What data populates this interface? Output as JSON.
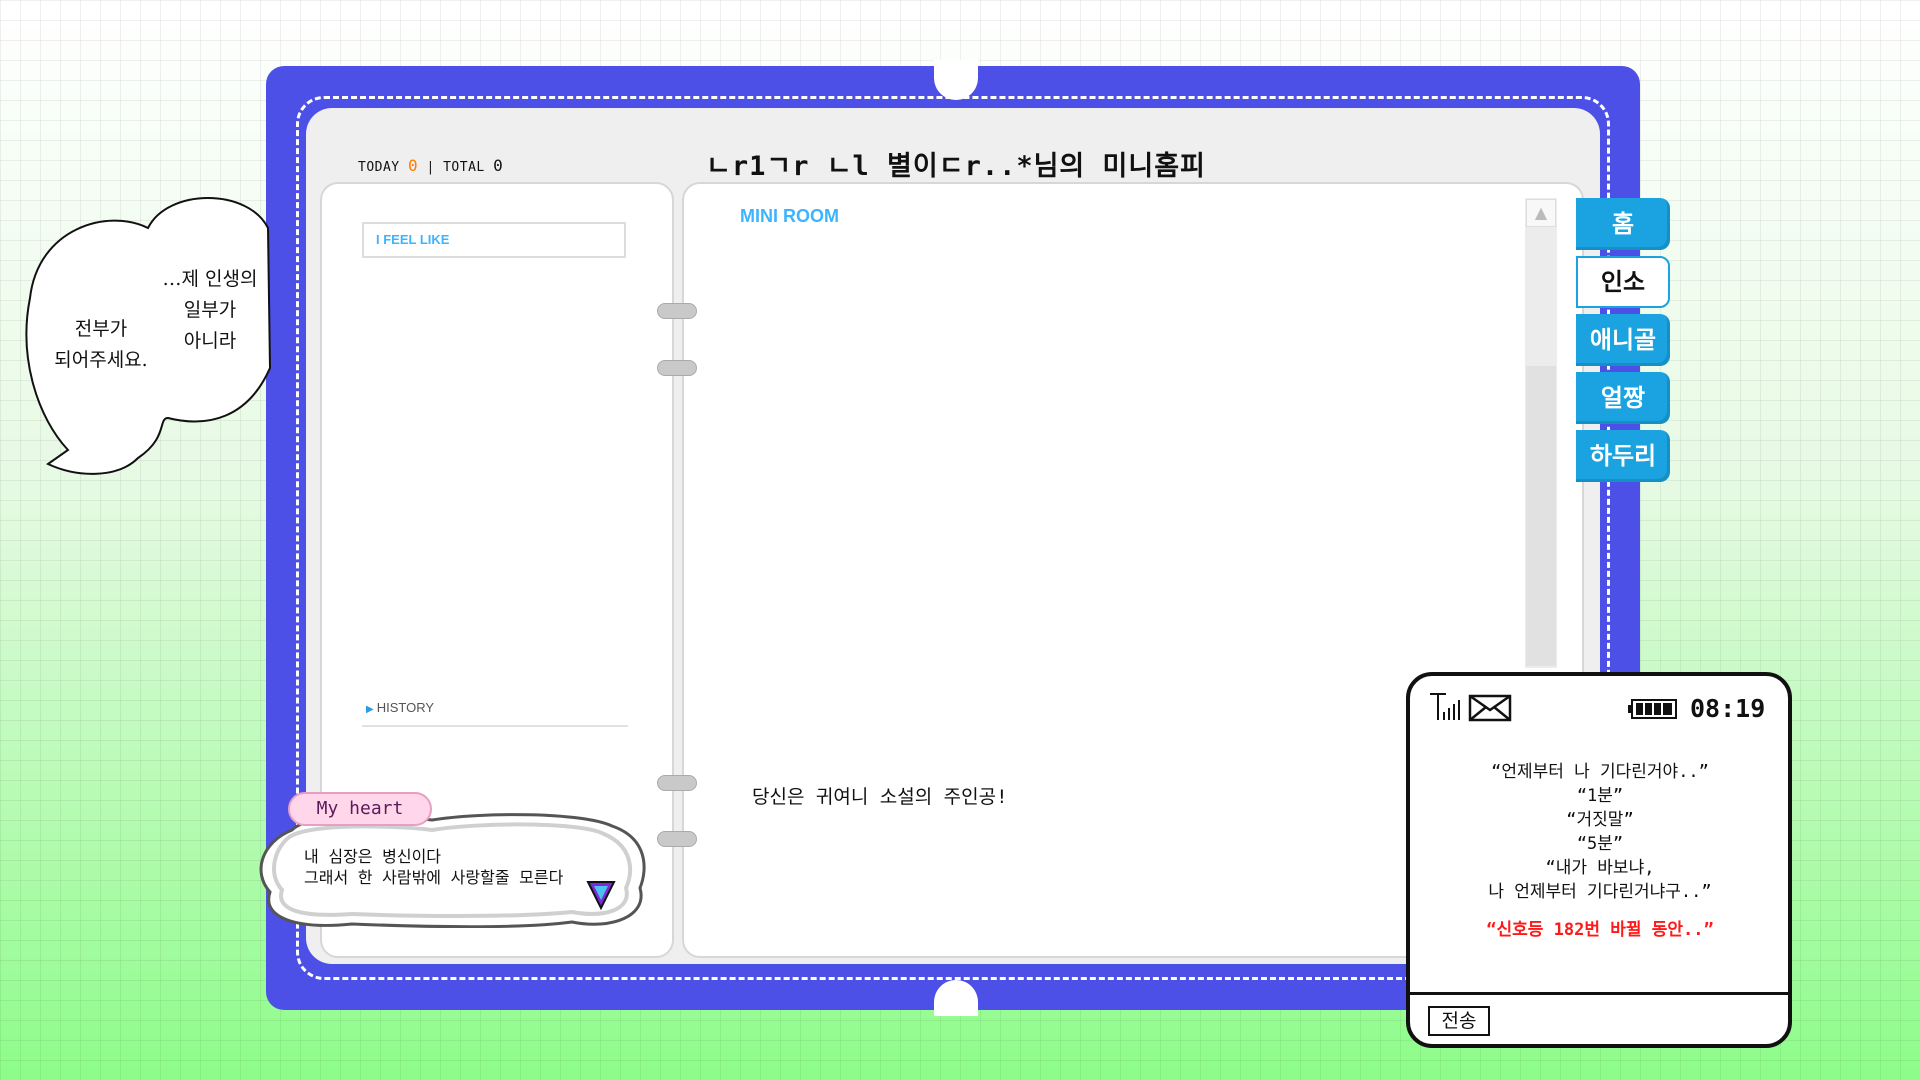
{
  "counter": {
    "today_label": "TODAY",
    "today_value": "0",
    "separator": "|",
    "total_label": "TOTAL",
    "total_value": "0"
  },
  "page_title": "ㄴr1ㄱr ㄴl 별이ㄷr..*님의 미니홈피",
  "left_panel": {
    "feel_label": "I FEEL LIKE",
    "history_label": "HISTORY"
  },
  "main": {
    "section_title": "MINI ROOM",
    "room_text": "당신은 귀여니 소설의 주인공!"
  },
  "tabs": [
    {
      "label": "홈",
      "active": false
    },
    {
      "label": "인소",
      "active": true
    },
    {
      "label": "애니골",
      "active": false
    },
    {
      "label": "얼짱",
      "active": false
    },
    {
      "label": "하두리",
      "active": false
    }
  ],
  "thought_cloud": {
    "line_right_1": "…제 인생의",
    "line_right_2": "일부가",
    "line_right_3": "아니라",
    "line_left_1": "전부가",
    "line_left_2": "되어주세요."
  },
  "heart": {
    "label": "My heart",
    "line1": "내 심장은 병신이다",
    "line2": "그래서 한 사람밖에 사랑할줄 모른다"
  },
  "phone": {
    "time": "08:19",
    "lines": [
      "“언제부터 나 기다린거야..”",
      "“1분”",
      "“거짓말”",
      "“5분”",
      "“내가 바보냐,",
      "나 언제부터 기다린거냐구..”"
    ],
    "highlight": "“신호등 182번 바뀔 동안..”",
    "send_label": "전송"
  },
  "colors": {
    "cover": "#4c50e6",
    "tab": "#1aa3e0",
    "accent_text": "#3db4ff",
    "highlight": "#ff1a1a",
    "today_count": "#ff7a00"
  }
}
